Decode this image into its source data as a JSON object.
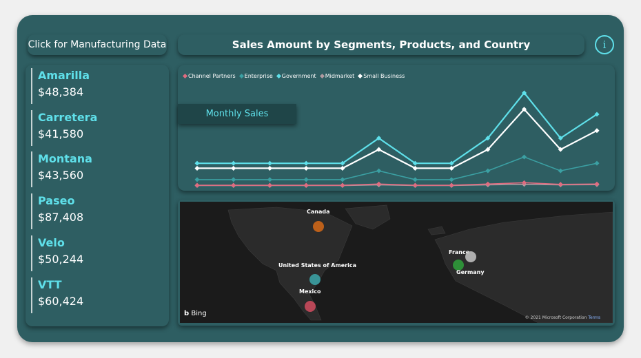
{
  "nav": {
    "manufacturing_button": "Click for Manufacturing Data"
  },
  "header": {
    "title": "Sales Amount by Segments, Products, and Country"
  },
  "info": {
    "glyph": "i"
  },
  "products": [
    {
      "name": "Amarilla",
      "value": "$48,384"
    },
    {
      "name": "Carretera",
      "value": "$41,580"
    },
    {
      "name": "Montana",
      "value": "$43,560"
    },
    {
      "name": "Paseo",
      "value": "$87,408"
    },
    {
      "name": "Velo",
      "value": "$50,244"
    },
    {
      "name": "VTT",
      "value": "$60,424"
    }
  ],
  "monthly_button": "Monthly Sales",
  "chart_data": {
    "type": "line",
    "x": [
      1,
      2,
      3,
      4,
      5,
      6,
      7,
      8,
      9,
      10,
      11,
      12
    ],
    "series": [
      {
        "name": "Channel Partners",
        "color": "#e06c80",
        "values": [
          0.5,
          0.5,
          0.5,
          0.5,
          0.5,
          1.5,
          0.5,
          0.5,
          1.5,
          2.5,
          1.2,
          1.5
        ]
      },
      {
        "name": "Enterprise",
        "color": "#3ba0a3",
        "values": [
          5,
          5,
          5,
          5,
          5,
          12,
          5,
          5,
          12,
          23,
          12,
          18
        ]
      },
      {
        "name": "Government",
        "color": "#5fe0ea",
        "values": [
          18,
          18,
          18,
          18,
          18,
          38,
          18,
          18,
          38,
          74,
          38,
          57
        ]
      },
      {
        "name": "Midmarket",
        "color": "#b09aa0",
        "values": [
          0.3,
          0.3,
          0.3,
          0.3,
          0.3,
          0.8,
          0.3,
          0.3,
          0.8,
          1.2,
          0.8,
          1
        ]
      },
      {
        "name": "Small Business",
        "color": "#ffffff",
        "values": [
          14,
          14,
          14,
          14,
          14,
          29,
          14,
          14,
          29,
          61,
          29,
          44
        ]
      }
    ],
    "ylim": [
      0,
      80
    ]
  },
  "map": {
    "provider": "Bing",
    "copyright": "© 2021 Microsoft Corporation",
    "terms": "Terms",
    "countries": [
      {
        "name": "Canada",
        "color": "#d66a17"
      },
      {
        "name": "United States of America",
        "color": "#3ba0a3"
      },
      {
        "name": "Mexico",
        "color": "#c94a5c"
      },
      {
        "name": "France",
        "color": "#bdbdbd"
      },
      {
        "name": "Germany",
        "color": "#2f9a3a"
      }
    ]
  }
}
